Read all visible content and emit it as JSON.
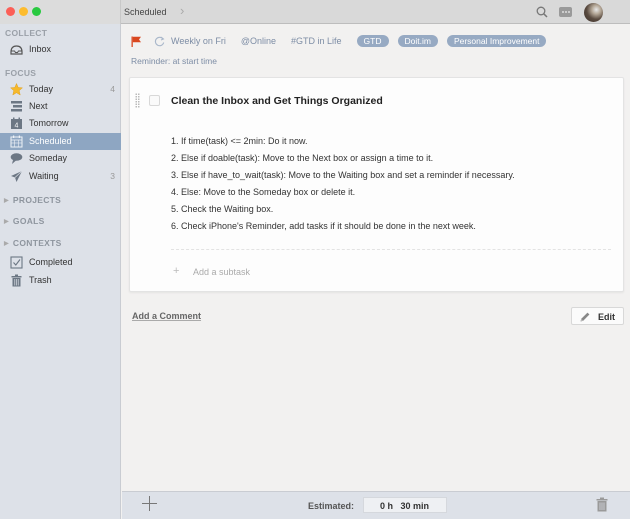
{
  "window": {
    "title": "Scheduled"
  },
  "toolbar": {
    "search_icon": "search-icon",
    "chat_icon": "chat-icon",
    "avatar": "user-avatar"
  },
  "sidebar": {
    "collect_label": "COLLECT",
    "inbox": {
      "label": "Inbox",
      "icon": "inbox-icon"
    },
    "focus_label": "FOCUS",
    "focus_items": [
      {
        "label": "Today",
        "count": "4",
        "icon": "star-icon"
      },
      {
        "label": "Next",
        "count": "",
        "icon": "next-list-icon"
      },
      {
        "label": "Tomorrow",
        "count": "",
        "icon": "calendar-4-icon"
      },
      {
        "label": "Scheduled",
        "count": "",
        "icon": "calendar-grid-icon",
        "active": true
      },
      {
        "label": "Someday",
        "count": "",
        "icon": "speech-bubble-icon"
      },
      {
        "label": "Waiting",
        "count": "3",
        "icon": "paper-plane-icon"
      }
    ],
    "groups": [
      "PROJECTS",
      "GOALS",
      "CONTEXTS"
    ],
    "bottom_items": [
      {
        "label": "Completed",
        "icon": "checkbox-icon"
      },
      {
        "label": "Trash",
        "icon": "trash-icon"
      }
    ]
  },
  "task": {
    "flag_color": "#d9471f",
    "repeat": "Weekly on Fri",
    "context": "@Online",
    "project": "#GTD in Life",
    "tags": [
      "GTD",
      "Doit.im",
      "Personal Improvement"
    ],
    "reminder": "Reminder: at start time",
    "title": "Clean the Inbox and Get Things Organized",
    "notes": [
      "1. If time(task) <= 2min: Do it now.",
      "2. Else if doable(task): Move to the Next box or assign a time to it.",
      "3. Else if have_to_wait(task): Move to the Waiting box and set a reminder if necessary.",
      "4. Else: Move to the Someday box or delete it.",
      "5. Check the Waiting box.",
      "6. Check iPhone's Reminder, add tasks if it should be done in the next week."
    ],
    "add_subtask_placeholder": "Add a subtask"
  },
  "actions": {
    "add_comment": "Add a Comment",
    "edit": "Edit"
  },
  "bottombar": {
    "estimated_label": "Estimated:",
    "estimated_value": "0 h   30 min"
  },
  "colors": {
    "accent": "#8ea6c2",
    "tag_bg": "#97aac3",
    "meta_text": "#7d8da5"
  }
}
